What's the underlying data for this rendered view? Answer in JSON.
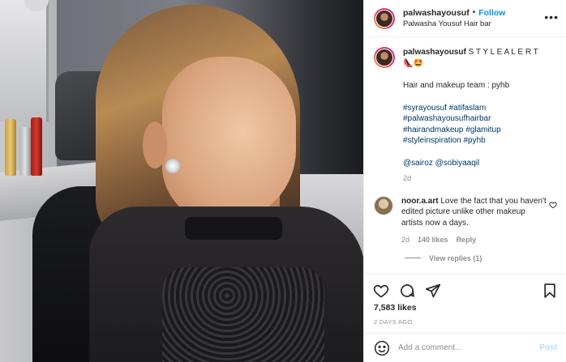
{
  "header": {
    "username": "palwashayousuf",
    "separator": "•",
    "follow_label": "Follow",
    "location": "Palwasha Yousuf Hair bar",
    "more_label": "•••"
  },
  "caption": {
    "username": "palwashayousuf",
    "text": "S T Y L E A L E R T",
    "emojis": "👠🤩",
    "team_line": "Hair and makeup team : pyhb",
    "hashtags": [
      "#syrayousuf #atifaslam",
      "#palwashayousufhairbar",
      "#hairandmakeup #glamitup",
      "#styleinspiration #pyhb"
    ],
    "mentions": "@sairoz @sobiyaaqil",
    "time": "2d"
  },
  "comment": {
    "username": "noor.a.art",
    "text": "Love the fact that you haven't edited picture unlike other makeup artists now a days.",
    "time": "2d",
    "likes": "140 likes",
    "reply_label": "Reply",
    "view_replies": "View replies (1)"
  },
  "actions": {
    "likes": "7,583 likes",
    "posted": "2 DAYS AGO"
  },
  "add_comment": {
    "placeholder": "Add a comment...",
    "post_label": "Post"
  },
  "colors": {
    "link": "#0095f6",
    "hashtag": "#00376b",
    "muted": "#8e8e8e",
    "post_disabled": "#b2dffc"
  },
  "icons": [
    "heart-icon",
    "comment-icon",
    "share-icon",
    "bookmark-icon",
    "smile-icon",
    "more-icon"
  ]
}
